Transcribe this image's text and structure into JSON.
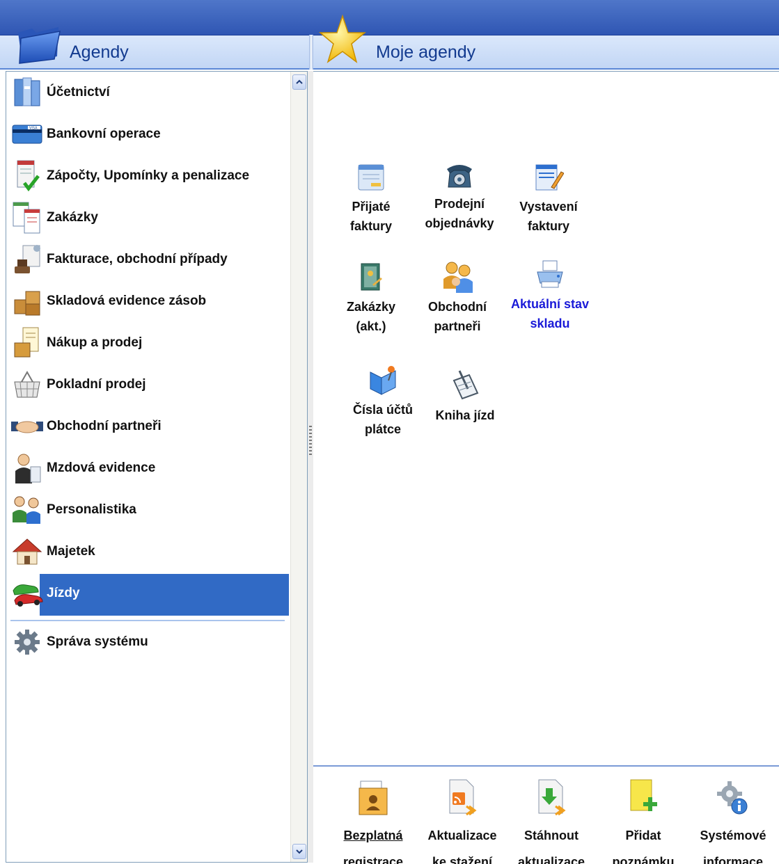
{
  "header": {
    "left_title": "Agendy",
    "right_title": "Moje agendy"
  },
  "agendas": [
    {
      "label": "Účetnictví",
      "icon": "ledger-icon"
    },
    {
      "label": "Bankovní operace",
      "icon": "credit-card-icon"
    },
    {
      "label": "Zápočty, Upomínky a penalizace",
      "icon": "document-check-icon"
    },
    {
      "label": "Zakázky",
      "icon": "forms-icon"
    },
    {
      "label": "Fakturace, obchodní případy",
      "icon": "invoice-stamp-icon"
    },
    {
      "label": "Skladová evidence zásob",
      "icon": "boxes-icon"
    },
    {
      "label": "Nákup a prodej",
      "icon": "box-document-icon"
    },
    {
      "label": "Pokladní prodej",
      "icon": "shopping-basket-icon"
    },
    {
      "label": "Obchodní partneři",
      "icon": "handshake-icon"
    },
    {
      "label": "Mzdová evidence",
      "icon": "employee-icon"
    },
    {
      "label": "Personalistika",
      "icon": "people-icon"
    },
    {
      "label": "Majetek",
      "icon": "house-icon"
    },
    {
      "label": "Jízdy",
      "icon": "cars-icon",
      "selected": true
    },
    {
      "label": "Správa systému",
      "icon": "gear-icon"
    }
  ],
  "shortcuts": [
    {
      "label1": "Přijaté",
      "label2": "faktury",
      "icon": "received-invoice-icon"
    },
    {
      "label1": "Prodejní",
      "label2": "objednávky",
      "icon": "telephone-icon"
    },
    {
      "label1": "Vystavení",
      "label2": "faktury",
      "icon": "issued-invoice-icon"
    },
    {
      "label1": "Zakázky",
      "label2": "(akt.)",
      "icon": "order-book-icon"
    },
    {
      "label1": "Obchodní",
      "label2": "partneři",
      "icon": "partners-icon"
    },
    {
      "label1": "Aktuální stav",
      "label2": "skladu",
      "icon": "printer-icon"
    },
    {
      "label1": "Čísla účtů",
      "label2": "plátce",
      "icon": "book-pin-icon"
    },
    {
      "label1": "Kniha jízd",
      "label2": "",
      "icon": "logbook-icon"
    }
  ],
  "toolbar": [
    {
      "label1": "Bezplatná",
      "label2": "registrace",
      "icon": "registration-folder-icon"
    },
    {
      "label1": "Aktualizace",
      "label2": "ke stažení",
      "icon": "rss-document-icon"
    },
    {
      "label1": "Stáhnout",
      "label2": "aktualizace",
      "icon": "download-document-icon"
    },
    {
      "label1": "Přidat",
      "label2": "poznámku",
      "icon": "add-note-icon"
    },
    {
      "label1": "Systémové",
      "label2": "informace",
      "icon": "system-info-icon"
    }
  ],
  "colors": {
    "selection": "#316ac5",
    "header_blue": "#2f56b3",
    "link_text": "#1a1ad8"
  }
}
